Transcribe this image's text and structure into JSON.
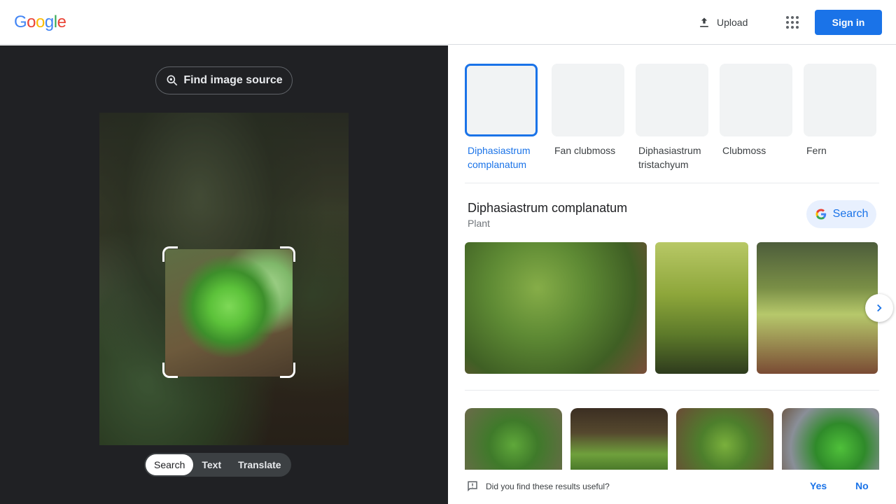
{
  "header": {
    "logo_letters": [
      {
        "ch": "G",
        "color": "#4285F4"
      },
      {
        "ch": "o",
        "color": "#EA4335"
      },
      {
        "ch": "o",
        "color": "#FBBC05"
      },
      {
        "ch": "g",
        "color": "#4285F4"
      },
      {
        "ch": "l",
        "color": "#34A853"
      },
      {
        "ch": "e",
        "color": "#EA4335"
      }
    ],
    "upload_label": "Upload",
    "signin_label": "Sign in",
    "apps_icon": "apps-grid-icon"
  },
  "left": {
    "find_source_label": "Find image source",
    "modes": [
      {
        "label": "Search",
        "active": true
      },
      {
        "label": "Text",
        "active": false
      },
      {
        "label": "Translate",
        "active": false
      }
    ]
  },
  "right": {
    "related": [
      {
        "label": "Diphasiastrum complanatum",
        "selected": true
      },
      {
        "label": "Fan clubmoss",
        "selected": false
      },
      {
        "label": "Diphasiastrum tristachyum",
        "selected": false
      },
      {
        "label": "Clubmoss",
        "selected": false
      },
      {
        "label": "Fern",
        "selected": false
      }
    ],
    "entity": {
      "title": "Diphasiastrum complanatum",
      "subtitle": "Plant",
      "search_label": "Search"
    },
    "feedback": {
      "question": "Did you find these results useful?",
      "yes": "Yes",
      "no": "No"
    }
  },
  "colors": {
    "accent": "#1a73e8",
    "dark_panel": "#202124"
  }
}
